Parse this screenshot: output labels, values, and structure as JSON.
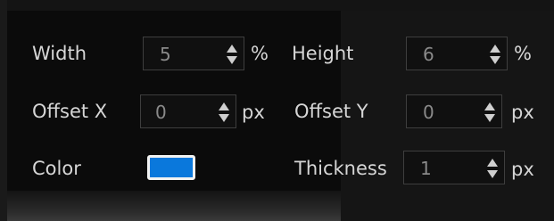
{
  "fields": {
    "width": {
      "label": "Width",
      "value": "5",
      "unit": "%"
    },
    "height": {
      "label": "Height",
      "value": "6",
      "unit": "%"
    },
    "offset_x": {
      "label": "Offset X",
      "value": "0",
      "unit": "px"
    },
    "offset_y": {
      "label": "Offset Y",
      "value": "0",
      "unit": "px"
    },
    "color": {
      "label": "Color",
      "value": "#0a78dc"
    },
    "thickness": {
      "label": "Thickness",
      "value": "1",
      "unit": "px"
    }
  }
}
